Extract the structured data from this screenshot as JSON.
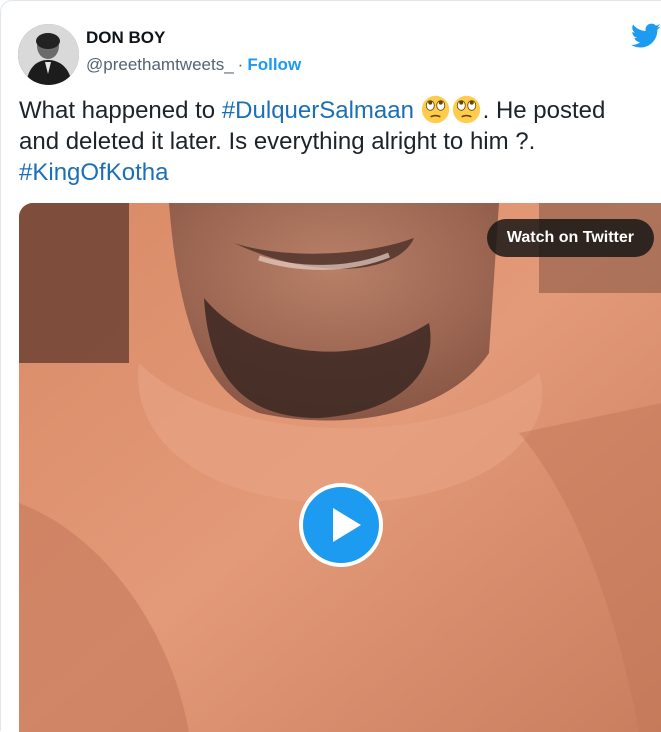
{
  "author": {
    "name": "DON BOY",
    "handle": "@preethamtweets_",
    "separator": "·",
    "follow_label": "Follow"
  },
  "platform_icon": "twitter-bird-icon",
  "tweet": {
    "line1_prefix": "What happened to ",
    "hashtag1": "#DulquerSalmaan",
    "emojis": [
      "face-with-rolling-eyes-emoji",
      "face-with-rolling-eyes-emoji"
    ],
    "line1_suffix": ". He posted and deleted it later. Is everything alright to him ?.",
    "hashtag2": "#KingOfKotha"
  },
  "media": {
    "watch_label": "Watch on Twitter",
    "play_icon": "play-icon"
  },
  "colors": {
    "link": "#1b6fb8",
    "follow": "#1d9bf0",
    "play_button": "#1d9bf0",
    "text": "#1c2329",
    "muted": "#536471"
  }
}
